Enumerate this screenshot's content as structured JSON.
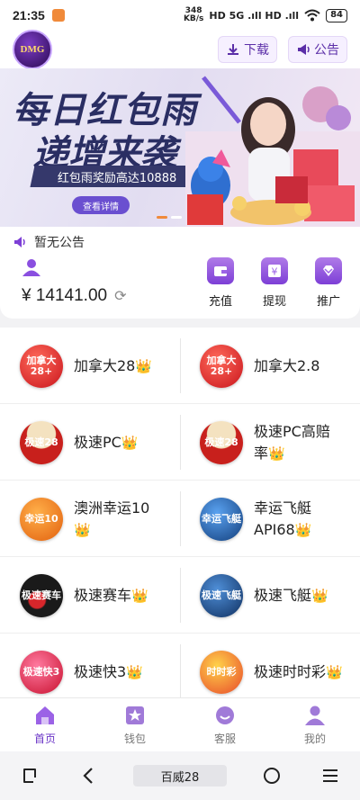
{
  "status_bar": {
    "time": "21:35",
    "net_speed_value": "348",
    "net_speed_unit": "KB/s",
    "signal": "HD 5G .ıll HD .ıll",
    "battery": "84"
  },
  "header": {
    "logo_text": "DMG",
    "download_label": "下载",
    "notice_label": "公告"
  },
  "banner": {
    "title_line1": "每日红包雨",
    "title_line2": "递增来袭",
    "subtitle": "红包雨奖励高达10888",
    "detail_button": "查看详情"
  },
  "notice_bar": {
    "text": "暂无公告"
  },
  "wallet": {
    "balance": "¥ 14141.00",
    "actions": [
      {
        "label": "充值",
        "icon": "wallet-icon"
      },
      {
        "label": "提现",
        "icon": "yuan-icon"
      },
      {
        "label": "推广",
        "icon": "diamond-icon"
      }
    ]
  },
  "games": [
    {
      "name": "加拿大28",
      "icon_text": "加拿大28+",
      "color": "#d9262b",
      "crown": "👑"
    },
    {
      "name": "加拿大2.8",
      "icon_text": "加拿大28+",
      "color": "#d9262b",
      "crown": ""
    },
    {
      "name": "极速PC",
      "icon_text": "极速28",
      "color": "#c8201c",
      "crown": "👑"
    },
    {
      "name": "极速PC高赔率",
      "icon_text": "极速28",
      "color": "#c8201c",
      "crown": "👑"
    },
    {
      "name": "澳洲幸运10",
      "icon_text": "幸运10",
      "color": "#f07a1a",
      "crown": "👑"
    },
    {
      "name": "幸运飞艇API68",
      "icon_text": "幸运飞艇",
      "color": "#1d5ea8",
      "crown": "👑"
    },
    {
      "name": "极速赛车",
      "icon_text": "极速赛车",
      "color": "#222222",
      "crown": "👑"
    },
    {
      "name": "极速飞艇",
      "icon_text": "极速飞艇",
      "color": "#1a4d8c",
      "crown": "👑"
    },
    {
      "name": "极速快3",
      "icon_text": "极速快3",
      "color": "#e0233a",
      "crown": "👑"
    },
    {
      "name": "极速时时彩",
      "icon_text": "时时彩",
      "color": "#e8492a",
      "crown": "👑"
    }
  ],
  "tabs": [
    {
      "label": "首页",
      "active": true
    },
    {
      "label": "钱包",
      "active": false
    },
    {
      "label": "客服",
      "active": false
    },
    {
      "label": "我的",
      "active": false
    }
  ],
  "navbar": {
    "app_label": "百威28"
  },
  "colors": {
    "accent": "#6b35c7",
    "banner_text": "#2a2e63"
  }
}
